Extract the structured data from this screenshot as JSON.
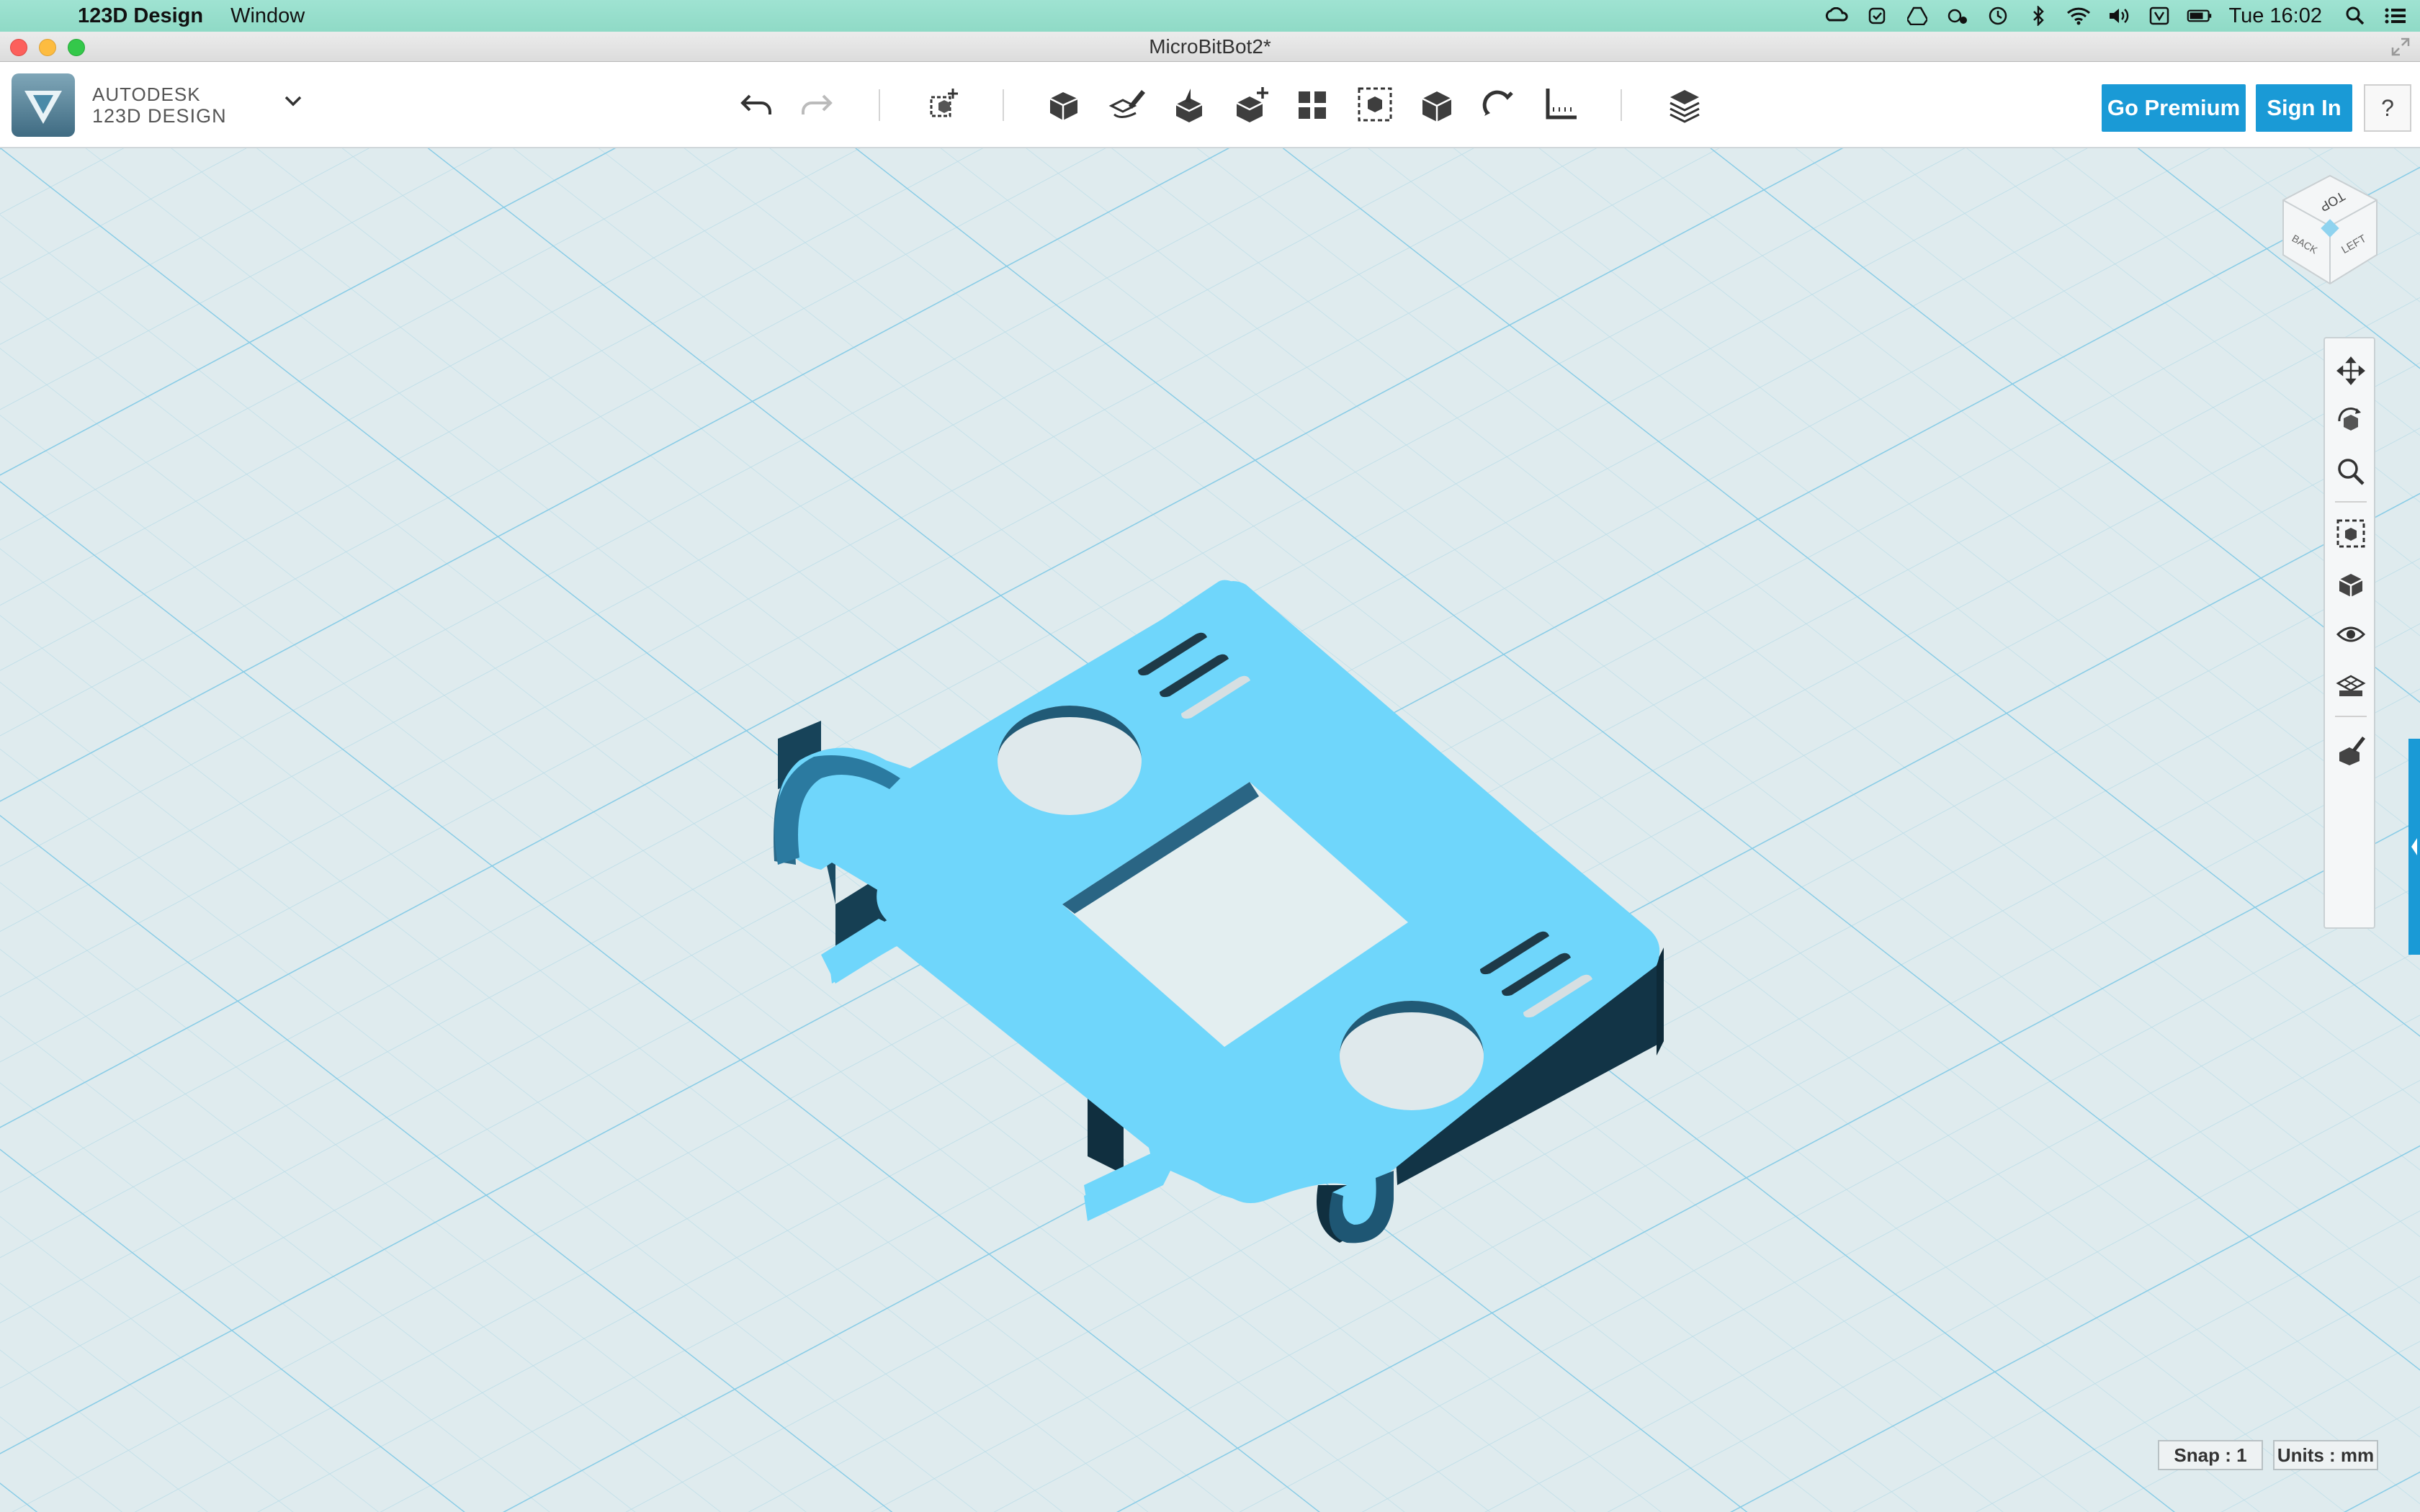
{
  "menubar": {
    "app_name": "123D Design",
    "menus": [
      "Window"
    ],
    "clock": "Tue 16:02"
  },
  "window": {
    "title": "MicroBitBot2*"
  },
  "brand": {
    "company": "AUTODESK",
    "product": "123D DESIGN"
  },
  "toolbar": {
    "go_premium": "Go Premium",
    "sign_in": "Sign In",
    "help": "?"
  },
  "viewcube": {
    "top": "TOP",
    "back": "BACK",
    "left": "LEFT"
  },
  "status": {
    "snap": "Snap : 1",
    "units": "Units : mm"
  },
  "colors": {
    "accent": "#1a9ad6",
    "model_top": "#6fd6fb",
    "model_side": "#1d4d66",
    "grid_major": "#8fd0ea",
    "grid_minor": "#c5e0e8"
  }
}
